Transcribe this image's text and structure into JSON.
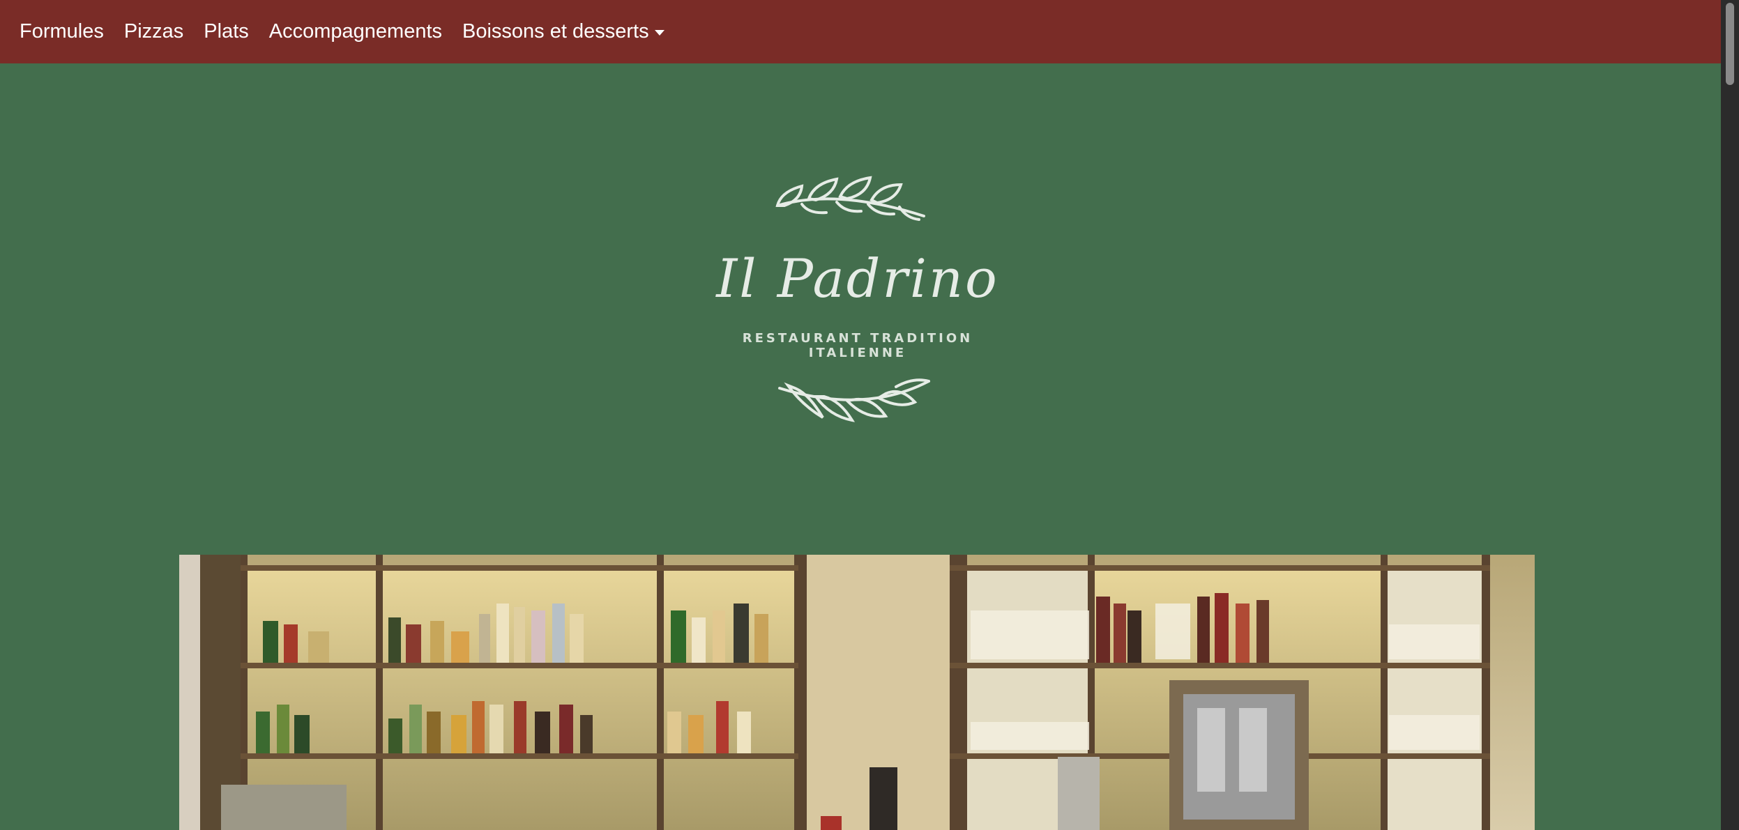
{
  "nav": {
    "items": [
      {
        "label": "Formules"
      },
      {
        "label": "Pizzas"
      },
      {
        "label": "Plats"
      },
      {
        "label": "Accompagnements"
      },
      {
        "label": "Boissons et desserts",
        "dropdown": true
      }
    ]
  },
  "logo": {
    "title": "Il Padrino",
    "subtitle": "RESTAURANT TRADITION ITALIENNE"
  },
  "hero": {
    "subject": "restaurant bar shelves with bottles"
  },
  "colors": {
    "navbar": "#7a2c27",
    "background": "#436e4d",
    "logo": "#e6ece6"
  }
}
